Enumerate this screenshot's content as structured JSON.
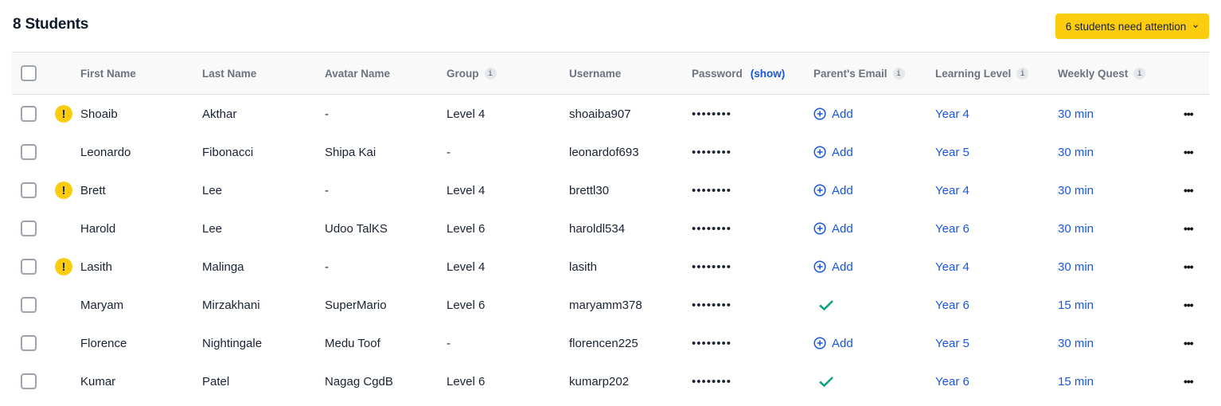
{
  "header": {
    "title": "8 Students",
    "attention_button": "6 students need attention"
  },
  "table": {
    "columns": {
      "first_name": "First Name",
      "last_name": "Last Name",
      "avatar_name": "Avatar Name",
      "group": "Group",
      "username": "Username",
      "password": "Password",
      "password_show": "(show)",
      "parents_email": "Parent's Email",
      "learning_level": "Learning Level",
      "weekly_quest": "Weekly Quest"
    },
    "info_glyph": "i",
    "password_mask": "••••••••",
    "add_label": "Add",
    "more_glyph": "•••",
    "warning_glyph": "!",
    "rows": [
      {
        "first": "Shoaib",
        "last": "Akthar",
        "avatar": "-",
        "group": "Level 4",
        "username": "shoaiba907",
        "email_status": "add",
        "level": "Year 4",
        "quest": "30 min",
        "attention": true
      },
      {
        "first": "Leonardo",
        "last": "Fibonacci",
        "avatar": "Shipa Kai",
        "group": "-",
        "username": "leonardof693",
        "email_status": "add",
        "level": "Year 5",
        "quest": "30 min",
        "attention": false
      },
      {
        "first": "Brett",
        "last": "Lee",
        "avatar": "-",
        "group": "Level 4",
        "username": "brettl30",
        "email_status": "add",
        "level": "Year 4",
        "quest": "30 min",
        "attention": true
      },
      {
        "first": "Harold",
        "last": "Lee",
        "avatar": "Udoo TalKS",
        "group": "Level 6",
        "username": "haroldl534",
        "email_status": "add",
        "level": "Year 6",
        "quest": "30 min",
        "attention": false
      },
      {
        "first": "Lasith",
        "last": "Malinga",
        "avatar": "-",
        "group": "Level 4",
        "username": "lasith",
        "email_status": "add",
        "level": "Year 4",
        "quest": "30 min",
        "attention": true
      },
      {
        "first": "Maryam",
        "last": "Mirzakhani",
        "avatar": "SuperMario",
        "group": "Level 6",
        "username": "maryamm378",
        "email_status": "set",
        "level": "Year 6",
        "quest": "15 min",
        "attention": false
      },
      {
        "first": "Florence",
        "last": "Nightingale",
        "avatar": "Medu Toof",
        "group": "-",
        "username": "florencen225",
        "email_status": "add",
        "level": "Year 5",
        "quest": "30 min",
        "attention": false
      },
      {
        "first": "Kumar",
        "last": "Patel",
        "avatar": "Nagag CgdB",
        "group": "Level 6",
        "username": "kumarp202",
        "email_status": "set",
        "level": "Year 6",
        "quest": "15 min",
        "attention": false
      }
    ]
  },
  "colors": {
    "accent_yellow": "#fdcc0d",
    "link_blue": "#1a56db",
    "success_green": "#10a37f"
  }
}
